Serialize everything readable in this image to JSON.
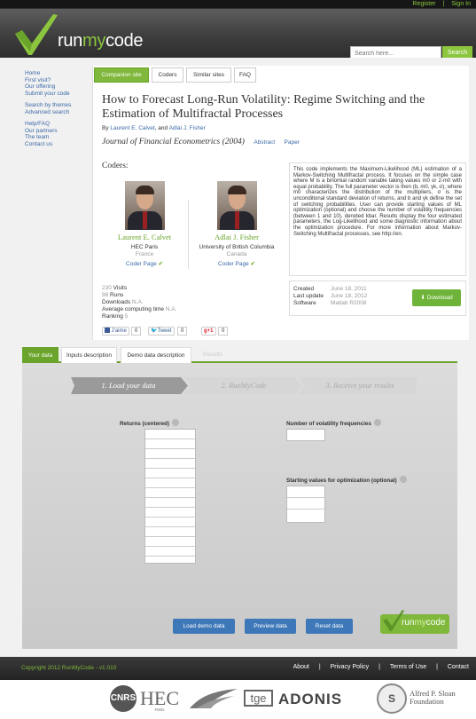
{
  "topbar": {
    "register": "Register",
    "sep": "|",
    "signin": "Sign In"
  },
  "header": {
    "logo_run": "run",
    "logo_my": "my",
    "logo_code": "code",
    "search_placeholder": "Search here...",
    "search_button": "Search"
  },
  "sidebar": {
    "group1": [
      "Home",
      "First visit?",
      "Our offering",
      "Submit your code"
    ],
    "group2": [
      "Search by themes",
      "Advanced search"
    ],
    "group3": [
      "Help/FAQ",
      "Our partners",
      "The team",
      "Contact us"
    ]
  },
  "tabs": [
    "Companion site",
    "Coders",
    "Similar sites",
    "FAQ"
  ],
  "article": {
    "title": "How to Forecast Long-Run Volatility: Regime Switching and the Estimation of Multifractal Processes",
    "by": "By",
    "author1": "Laurent E. Calvet",
    "and": ", and",
    "author2": "Adlai J. Fisher",
    "journal": "Journal of Financial Econometrics (2004)",
    "abstract": "Abstract",
    "paper": "Paper"
  },
  "coders": {
    "title": "Coders:",
    "list": [
      {
        "name": "Laurent E. Calvet",
        "institution": "HEC Paris",
        "country": "France",
        "page": "Coder Page"
      },
      {
        "name": "Adlai J. Fisher",
        "institution": "University of British Columbia",
        "country": "Canada",
        "page": "Coder Page"
      }
    ]
  },
  "description": "This code implements the Maximum-Likelihood (ML) estimation of a Markov-Switching Multifractal process. It focuses on the simple case where M is a binomial random variable taking values m0 or 2-m0 with equal probability. The full parameter vector is then (b, m0, γk, σ), where m0 characterizes the distribution of the multipliers, σ is the unconditional standard deviation of returns, and b and γk define the set of switching probabilities. User can provide starting values of ML optimization (optional) and choose the number of volatility frequencies (between 1 and 10), denoted kbar. Results display the four estimated parameters, the Log-Likelihood and some diagnostic information about the optimization procedure. For more information about Markov-Switching Multifractal processes, see http://en.",
  "stats": {
    "visits_num": "230",
    "visits_label": "Visits",
    "runs_num": "98",
    "runs_label": "Runs",
    "downloads_label": "Downloads",
    "downloads_val": "N.A.",
    "avg_label": "Average computing time",
    "avg_val": "N.A.",
    "ranking_label": "Ranking",
    "ranking_val": "5"
  },
  "social": {
    "share": "J'aime",
    "share_count": "0",
    "tweet": "Tweet",
    "tweet_count": "0",
    "gplus": "+1",
    "gplus_count": "0"
  },
  "meta": {
    "created_label": "Created",
    "created": "June 18, 2011",
    "updated_label": "Last update",
    "updated": "June 18, 2012",
    "software_label": "Software",
    "software": "Matlab R2008"
  },
  "download_button": "Download",
  "tabs2": [
    "Your data",
    "Inputs description",
    "Demo data description",
    "Results"
  ],
  "steps": [
    "1. Load your data",
    "2. RunMyCode",
    "3. Receive your results"
  ],
  "form": {
    "returns_label": "Returns (centered)",
    "freq_label": "Number of volatility frequencies",
    "start_label": "Starting values for optimization (optional)"
  },
  "buttons": {
    "load_demo": "Load demo data",
    "preview": "Preview data",
    "reset": "Reset data"
  },
  "badge": {
    "run": "run",
    "my": "my",
    "code": "code"
  },
  "footer": {
    "copyright": "Copyright 2012 RunMyCode - v1.010",
    "links": [
      "About",
      "|",
      "Privacy Policy",
      "|",
      "Terms of Use",
      "|",
      "Contact"
    ]
  },
  "partners": [
    "CNRS",
    "HEC",
    "PARIS",
    "tge",
    "ADONIS",
    "Alfred P. Sloan",
    "Foundation"
  ],
  "colors": {
    "accent": "#7fb83a",
    "link": "#3a6aa8",
    "button_blue": "#3e78b8",
    "dark": "#2e2e2e"
  }
}
